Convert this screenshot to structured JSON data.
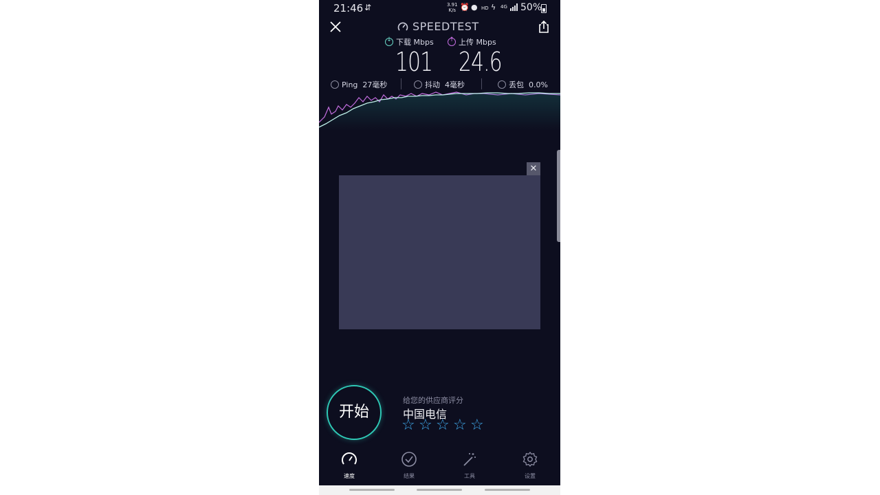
{
  "status": {
    "time": "21:46",
    "sync": "⇵",
    "rate_value": "3.91",
    "rate_unit": "K/s",
    "hd": "HD",
    "net": "4G",
    "battery": "50%"
  },
  "header": {
    "brand": "SPEEDTEST"
  },
  "download": {
    "label": "下载 Mbps",
    "value": "101",
    "color": "#69d6c5"
  },
  "upload": {
    "label": "上传 Mbps",
    "value": "24.6",
    "color": "#c46ee0"
  },
  "stats": {
    "ping_label": "Ping",
    "ping_value": "27毫秒",
    "jitter_label": "抖动",
    "jitter_value": "4毫秒",
    "loss_label": "丢包",
    "loss_value": "0.0%"
  },
  "ad": {
    "close": "✕"
  },
  "start": {
    "label": "开始"
  },
  "rating": {
    "prompt": "给您的供应商评分",
    "provider": "中国电信",
    "stars": 5,
    "filled": 0
  },
  "nav": [
    {
      "label": "速度",
      "icon": "speed-gauge-icon",
      "active": true
    },
    {
      "label": "结果",
      "icon": "check-circle-icon",
      "active": false
    },
    {
      "label": "工具",
      "icon": "magic-wand-icon",
      "active": false
    },
    {
      "label": "设置",
      "icon": "gear-icon",
      "active": false
    }
  ],
  "colors": {
    "background": "#0d0e1f",
    "accent_teal": "#2fc9b6",
    "star_blue": "#3fa7e8",
    "ad_placeholder": "#393a56"
  }
}
